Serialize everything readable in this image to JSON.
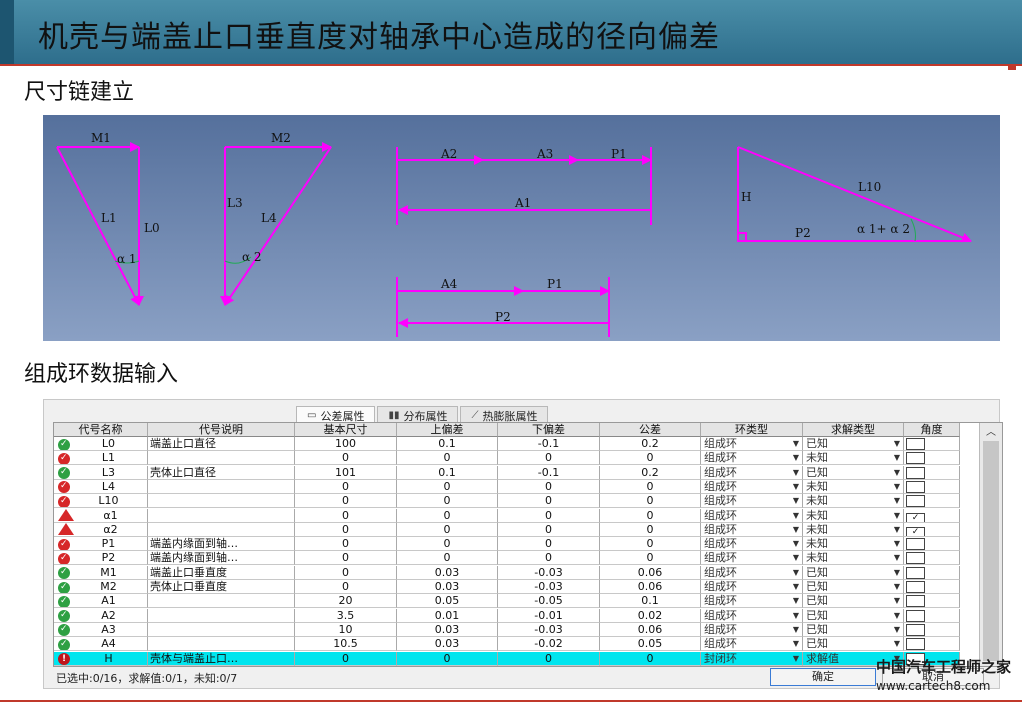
{
  "slide": {
    "title": "机壳与端盖止口垂直度对轴承中心造成的径向偏差",
    "section1": "尺寸链建立",
    "section2": "组成环数据输入"
  },
  "colors": {
    "title_bar": "#2e6e8c",
    "diagram_bg": "#5e7aa3",
    "magenta": "#ff00ff",
    "highlight_row": "#00e5ee"
  },
  "diagram": {
    "labels": [
      "M1",
      "L1",
      "L0",
      "α 1",
      "M2",
      "L3",
      "L4",
      "α 2",
      "A2",
      "A3",
      "P1",
      "A1",
      "A4",
      "P1",
      "P2",
      "H",
      "L10",
      "P2",
      "α 1+ α 2"
    ]
  },
  "dialog": {
    "tabs": [
      {
        "icon": "ruler-icon",
        "label": "公差属性"
      },
      {
        "icon": "bar-chart-icon",
        "label": "分布属性"
      },
      {
        "icon": "thermal-icon",
        "label": "热膨胀属性"
      }
    ],
    "headers": [
      "代号名称",
      "代号说明",
      "基本尺寸",
      "上偏差",
      "下偏差",
      "公差",
      "环类型",
      "求解类型",
      "角度"
    ],
    "rows": [
      {
        "status": "ok",
        "code": "L0",
        "desc": "端盖止口直径",
        "basic": "100",
        "upper": "0.1",
        "lower": "-0.1",
        "tol": "0.2",
        "ring": "组成环",
        "solve": "已知",
        "angle": ""
      },
      {
        "status": "bad",
        "code": "L1",
        "desc": "",
        "basic": "0",
        "upper": "0",
        "lower": "0",
        "tol": "0",
        "ring": "组成环",
        "solve": "未知",
        "angle": ""
      },
      {
        "status": "ok",
        "code": "L3",
        "desc": "壳体止口直径",
        "basic": "101",
        "upper": "0.1",
        "lower": "-0.1",
        "tol": "0.2",
        "ring": "组成环",
        "solve": "已知",
        "angle": ""
      },
      {
        "status": "bad",
        "code": "L4",
        "desc": "",
        "basic": "0",
        "upper": "0",
        "lower": "0",
        "tol": "0",
        "ring": "组成环",
        "solve": "未知",
        "angle": ""
      },
      {
        "status": "bad",
        "code": "L10",
        "desc": "",
        "basic": "0",
        "upper": "0",
        "lower": "0",
        "tol": "0",
        "ring": "组成环",
        "solve": "未知",
        "angle": ""
      },
      {
        "status": "warn",
        "code": "α1",
        "desc": "",
        "basic": "0",
        "upper": "0",
        "lower": "0",
        "tol": "0",
        "ring": "组成环",
        "solve": "未知",
        "angle": "✓"
      },
      {
        "status": "warn",
        "code": "α2",
        "desc": "",
        "basic": "0",
        "upper": "0",
        "lower": "0",
        "tol": "0",
        "ring": "组成环",
        "solve": "未知",
        "angle": "✓"
      },
      {
        "status": "bad",
        "code": "P1",
        "desc": "端盖内缘面到轴…",
        "basic": "0",
        "upper": "0",
        "lower": "0",
        "tol": "0",
        "ring": "组成环",
        "solve": "未知",
        "angle": ""
      },
      {
        "status": "bad",
        "code": "P2",
        "desc": "端盖内缘面到轴…",
        "basic": "0",
        "upper": "0",
        "lower": "0",
        "tol": "0",
        "ring": "组成环",
        "solve": "未知",
        "angle": ""
      },
      {
        "status": "ok",
        "code": "M1",
        "desc": "端盖止口垂直度",
        "basic": "0",
        "upper": "0.03",
        "lower": "-0.03",
        "tol": "0.06",
        "ring": "组成环",
        "solve": "已知",
        "angle": ""
      },
      {
        "status": "ok",
        "code": "M2",
        "desc": "壳体止口垂直度",
        "basic": "0",
        "upper": "0.03",
        "lower": "-0.03",
        "tol": "0.06",
        "ring": "组成环",
        "solve": "已知",
        "angle": ""
      },
      {
        "status": "ok",
        "code": "A1",
        "desc": "",
        "basic": "20",
        "upper": "0.05",
        "lower": "-0.05",
        "tol": "0.1",
        "ring": "组成环",
        "solve": "已知",
        "angle": ""
      },
      {
        "status": "ok",
        "code": "A2",
        "desc": "",
        "basic": "3.5",
        "upper": "0.01",
        "lower": "-0.01",
        "tol": "0.02",
        "ring": "组成环",
        "solve": "已知",
        "angle": ""
      },
      {
        "status": "ok",
        "code": "A3",
        "desc": "",
        "basic": "10",
        "upper": "0.03",
        "lower": "-0.03",
        "tol": "0.06",
        "ring": "组成环",
        "solve": "已知",
        "angle": ""
      },
      {
        "status": "ok",
        "code": "A4",
        "desc": "",
        "basic": "10.5",
        "upper": "0.03",
        "lower": "-0.02",
        "tol": "0.05",
        "ring": "组成环",
        "solve": "已知",
        "angle": ""
      },
      {
        "status": "err",
        "code": "H",
        "desc": "壳体与端盖止口…",
        "basic": "0",
        "upper": "0",
        "lower": "0",
        "tol": "0",
        "ring": "封闭环",
        "solve": "求解值",
        "angle": "",
        "highlight": true
      }
    ],
    "status_text": "已选中:0/16，求解值:0/1，未知:0/7",
    "ok_label": "确定",
    "cancel_label": "取消"
  },
  "watermark": {
    "cn": "中国汽车工程师之家",
    "url": "www.cartech8.com"
  }
}
